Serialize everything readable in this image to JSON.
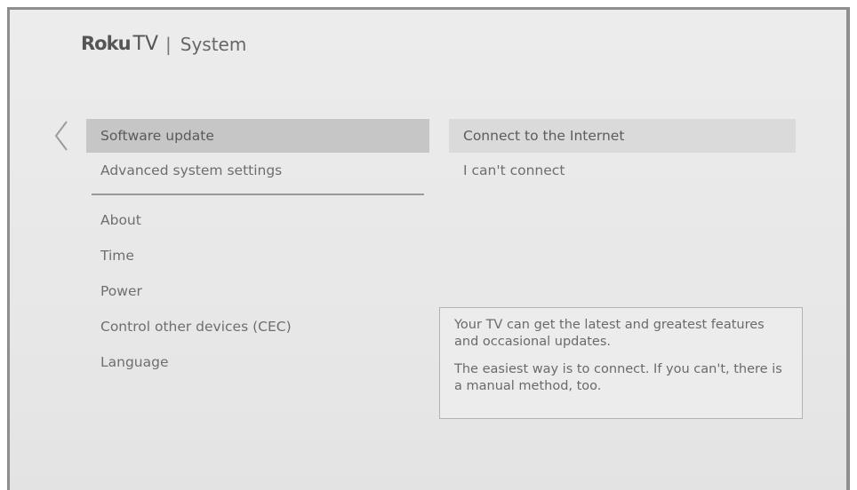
{
  "header": {
    "logo_brand": "Roku",
    "logo_tv": "TV",
    "separator": "|",
    "title": "System"
  },
  "nav": {
    "back_icon": "chevron-left-icon"
  },
  "menu": {
    "items": [
      {
        "label": "Software update"
      },
      {
        "label": "Advanced system settings"
      },
      {
        "label": "About"
      },
      {
        "label": "Time"
      },
      {
        "label": "Power"
      },
      {
        "label": "Control other devices (CEC)"
      },
      {
        "label": "Language"
      }
    ],
    "selected_index": 0
  },
  "options": {
    "items": [
      {
        "label": "Connect to the Internet"
      },
      {
        "label": "I can't connect"
      }
    ]
  },
  "info": {
    "paragraph1": "Your TV can get the latest and greatest features and occasional updates.",
    "paragraph2": "The easiest way is to connect. If you can't, there is a manual method, too."
  },
  "colors": {
    "selected_bg": "#c6c6c6",
    "highlight_bg": "#dadada",
    "text": "#6e6e6e"
  }
}
